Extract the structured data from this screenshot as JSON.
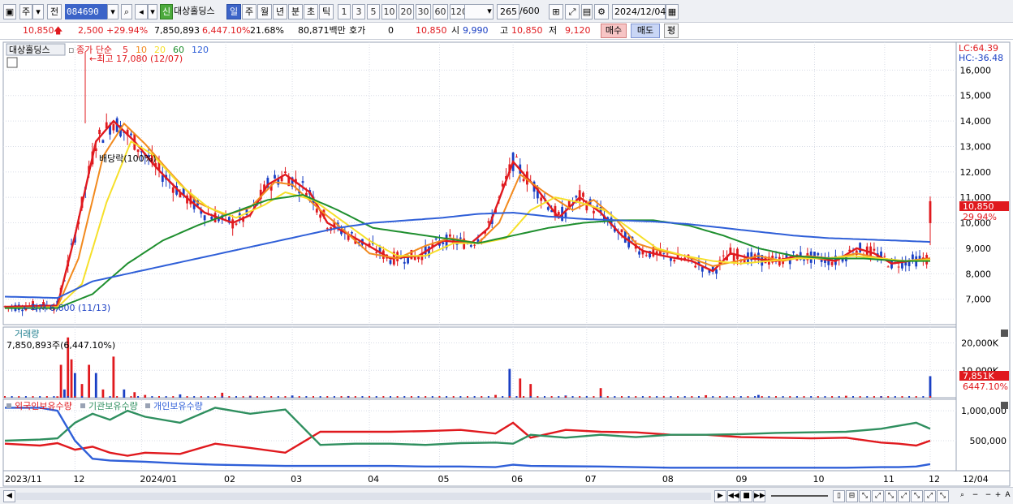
{
  "toolbar": {
    "market": "주",
    "prev_label": "전",
    "stock_code": "084690",
    "stock_name": "대상홀딩스",
    "new_badge": "신",
    "periods": [
      "일",
      "주",
      "월",
      "년",
      "분",
      "초",
      "틱"
    ],
    "active_period": "일",
    "minute_options": [
      "1",
      "3",
      "5",
      "10",
      "20",
      "30",
      "60",
      "120"
    ],
    "count": "265",
    "count_total": "/600",
    "date": "2024/12/04"
  },
  "quote": {
    "price": "10,850",
    "change": "2,500",
    "change_pct": "+29.94%",
    "volume": "7,850,893",
    "volume_pct": "6,447.10%",
    "turnover": "21.68%",
    "trade_value": "80,871백만",
    "bid_label": "호가",
    "bid_value": "0",
    "ask_value": "10,850",
    "open_label": "시",
    "open": "9,990",
    "high_label": "고",
    "high": "10,850",
    "low_label": "저",
    "low": "9,120",
    "buy_label": "매수",
    "sell_label": "매도",
    "avg_label": "평"
  },
  "price_panel": {
    "name": "대상홀딩스",
    "legend_prefix": "종가 단순",
    "ma_periods": [
      "5",
      "10",
      "20",
      "60",
      "120"
    ],
    "ma_colors": [
      "#e0191e",
      "#f28a1e",
      "#f6e02a",
      "#1f8f2f",
      "#2f5fd8"
    ],
    "lc": "LC:64.39",
    "hc": "HC:-36.48",
    "high_annotation": "최고 17,080 (12/07)",
    "low_annotation": "최저 6,600 (11/13)",
    "dividend_annotation": "배당락(100%)",
    "last_price_label": "10,850",
    "last_pct_label": "29.94%"
  },
  "volume_panel": {
    "title": "거래량",
    "summary": "7,850,893주(6,447.10%)",
    "last_label": "7,851K",
    "last_pct": "6447.10%"
  },
  "holdings_panel": {
    "series": [
      "외국인보유수량",
      "기관보유수량",
      "개인보유수량"
    ]
  },
  "x_axis": {
    "labels": [
      "2023/11",
      "12",
      "2024/01",
      "02",
      "03",
      "04",
      "05",
      "06",
      "07",
      "08",
      "09",
      "10",
      "11",
      "12",
      "12/04"
    ]
  },
  "chart_data": [
    {
      "type": "candlestick",
      "title": "대상홀딩스",
      "y_ticks": [
        7000,
        8000,
        9000,
        10000,
        11000,
        12000,
        13000,
        14000,
        15000,
        16000
      ],
      "ylim": [
        6000,
        17000
      ],
      "series": [
        {
          "name": "5",
          "color": "#e0191e",
          "x": [
            0,
            15,
            20,
            26,
            31,
            37,
            43,
            50,
            57,
            65,
            70,
            75,
            80,
            87,
            92,
            100,
            110,
            118,
            125,
            133,
            138,
            145,
            152,
            158,
            164,
            170,
            176,
            182,
            188,
            196,
            202,
            207,
            213,
            220,
            226,
            232,
            237,
            243,
            248,
            253,
            258,
            264
          ],
          "y": [
            6700,
            6750,
            9500,
            13200,
            14000,
            13200,
            12200,
            11200,
            10400,
            10000,
            10300,
            11500,
            11900,
            11200,
            10000,
            9400,
            8600,
            8700,
            9300,
            9200,
            9800,
            12400,
            11300,
            10200,
            11000,
            10400,
            9500,
            8900,
            8700,
            8500,
            8100,
            8800,
            8600,
            8500,
            8700,
            8600,
            8500,
            9000,
            8800,
            8400,
            8500,
            8600
          ]
        },
        {
          "name": "10",
          "color": "#f28a1e",
          "x": [
            0,
            15,
            21,
            28,
            34,
            40,
            47,
            55,
            63,
            70,
            77,
            82,
            90,
            96,
            104,
            112,
            120,
            127,
            135,
            141,
            147,
            154,
            162,
            168,
            174,
            180,
            187,
            194,
            202,
            209,
            215,
            222,
            229,
            236,
            243,
            250,
            257,
            264
          ],
          "y": [
            6650,
            6700,
            8600,
            12600,
            13900,
            13100,
            12000,
            10800,
            10300,
            10600,
            11600,
            11500,
            10500,
            9800,
            8800,
            8600,
            9100,
            9400,
            9200,
            10000,
            11900,
            11200,
            10500,
            10900,
            10200,
            9200,
            8900,
            8700,
            8300,
            8500,
            8700,
            8500,
            8700,
            8600,
            8800,
            8600,
            8500,
            8600
          ]
        },
        {
          "name": "20",
          "color": "#f6e02a",
          "x": [
            0,
            15,
            22,
            29,
            36,
            42,
            50,
            58,
            66,
            74,
            80,
            88,
            95,
            104,
            112,
            120,
            128,
            136,
            143,
            150,
            157,
            164,
            171,
            178,
            186,
            194,
            202,
            210,
            218,
            226,
            234,
            242,
            250,
            257,
            264
          ],
          "y": [
            6650,
            6680,
            7600,
            10800,
            13200,
            12700,
            11500,
            10600,
            10200,
            10700,
            11200,
            10900,
            10200,
            9300,
            8700,
            8700,
            9200,
            9200,
            9400,
            10500,
            11000,
            10800,
            10500,
            9800,
            9000,
            8700,
            8500,
            8400,
            8500,
            8600,
            8600,
            8700,
            8600,
            8500,
            8550
          ]
        },
        {
          "name": "60",
          "color": "#1f8f2f",
          "x": [
            0,
            15,
            25,
            35,
            45,
            55,
            65,
            75,
            85,
            95,
            105,
            115,
            125,
            135,
            145,
            155,
            165,
            175,
            185,
            195,
            205,
            215,
            225,
            235,
            245,
            255,
            264
          ],
          "y": [
            6650,
            6650,
            7200,
            8400,
            9300,
            9900,
            10400,
            10900,
            11100,
            10500,
            9800,
            9600,
            9400,
            9200,
            9500,
            9800,
            10000,
            10100,
            10100,
            9900,
            9500,
            9000,
            8700,
            8600,
            8600,
            8500,
            8500
          ]
        },
        {
          "name": "120",
          "color": "#2f5fd8",
          "x": [
            0,
            15,
            25,
            35,
            45,
            55,
            65,
            75,
            85,
            95,
            105,
            115,
            125,
            135,
            145,
            155,
            165,
            175,
            185,
            195,
            205,
            215,
            225,
            235,
            245,
            255,
            264
          ],
          "y": [
            7100,
            7050,
            7700,
            8000,
            8300,
            8600,
            8900,
            9200,
            9500,
            9800,
            10000,
            10100,
            10200,
            10350,
            10400,
            10250,
            10150,
            10100,
            10050,
            9950,
            9800,
            9650,
            9500,
            9400,
            9350,
            9300,
            9250
          ]
        }
      ]
    },
    {
      "type": "bar",
      "title": "거래량",
      "y_ticks": [
        10000,
        20000
      ],
      "y_tick_labels": [
        "10,000K",
        "20,000K"
      ],
      "ylim": [
        0,
        24000
      ],
      "x": [
        15,
        16,
        17,
        18,
        19,
        20,
        22,
        24,
        26,
        28,
        31,
        34,
        37,
        40,
        50,
        62,
        70,
        82,
        98,
        140,
        144,
        147,
        150,
        160,
        170,
        200,
        215,
        240,
        250,
        264
      ],
      "values": [
        500,
        12000,
        3000,
        22000,
        14000,
        9000,
        5000,
        12000,
        9000,
        3000,
        15000,
        3000,
        2000,
        1000,
        1200,
        1800,
        700,
        800,
        600,
        1000,
        10500,
        7000,
        5000,
        800,
        3500,
        900,
        1000,
        700,
        500,
        7851
      ]
    },
    {
      "type": "line",
      "title": "보유수량",
      "y_ticks": [
        500000,
        1000000
      ],
      "y_tick_labels": [
        "500,000",
        "1,000,000"
      ],
      "ylim": [
        0,
        1150000
      ],
      "x": [
        0,
        10,
        15,
        20,
        25,
        30,
        35,
        40,
        50,
        60,
        70,
        80,
        90,
        100,
        110,
        120,
        130,
        140,
        145,
        150,
        160,
        170,
        180,
        190,
        200,
        210,
        220,
        230,
        240,
        250,
        255,
        260,
        264
      ],
      "series": [
        {
          "name": "외국인보유수량",
          "color": "#e0191e",
          "values": [
            450000,
            420000,
            460000,
            350000,
            400000,
            300000,
            250000,
            300000,
            280000,
            450000,
            380000,
            300000,
            650000,
            650000,
            650000,
            660000,
            680000,
            620000,
            800000,
            550000,
            680000,
            650000,
            640000,
            600000,
            600000,
            560000,
            550000,
            540000,
            550000,
            470000,
            450000,
            420000,
            500000
          ]
        },
        {
          "name": "기관보유수량",
          "color": "#2f8f5f",
          "values": [
            500000,
            520000,
            540000,
            800000,
            950000,
            850000,
            1000000,
            900000,
            800000,
            1050000,
            950000,
            1020000,
            430000,
            450000,
            450000,
            430000,
            460000,
            470000,
            450000,
            600000,
            550000,
            600000,
            560000,
            600000,
            600000,
            610000,
            630000,
            640000,
            650000,
            700000,
            750000,
            800000,
            700000
          ]
        },
        {
          "name": "개인보유수량",
          "color": "#2f5fd8",
          "values": [
            1050000,
            1050000,
            1000000,
            500000,
            200000,
            170000,
            160000,
            150000,
            120000,
            100000,
            90000,
            80000,
            80000,
            80000,
            80000,
            70000,
            70000,
            60000,
            100000,
            80000,
            75000,
            70000,
            60000,
            50000,
            50000,
            50000,
            50000,
            50000,
            50000,
            60000,
            60000,
            70000,
            110000
          ]
        }
      ]
    }
  ]
}
